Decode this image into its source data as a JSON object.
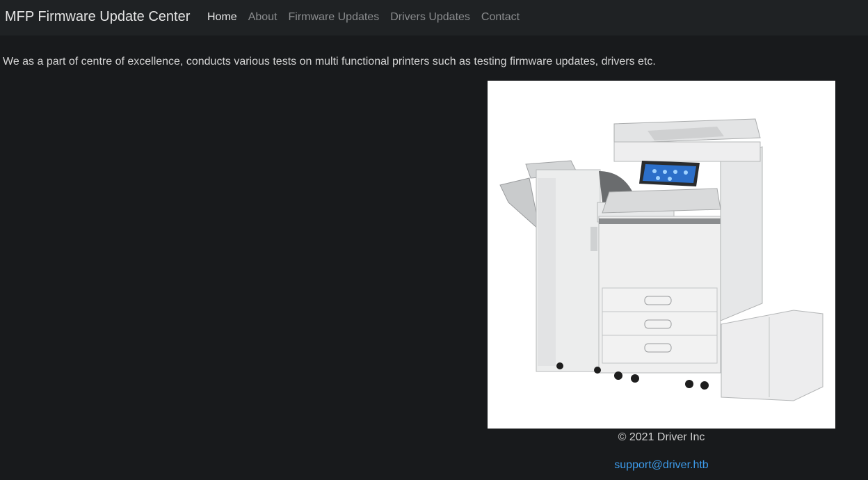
{
  "navbar": {
    "brand": "MFP Firmware Update Center",
    "links": [
      {
        "label": "Home",
        "active": true
      },
      {
        "label": "About",
        "active": false
      },
      {
        "label": "Firmware Updates",
        "active": false
      },
      {
        "label": "Drivers Updates",
        "active": false
      },
      {
        "label": "Contact",
        "active": false
      }
    ]
  },
  "main": {
    "intro": "We as a part of centre of excellence, conducts various tests on multi functional printers such as testing firmware updates, drivers etc.",
    "image": "printer-photo"
  },
  "footer": {
    "copyright": "© 2021 Driver Inc",
    "email": "support@driver.htb"
  },
  "colors": {
    "background": "#181a1c",
    "navbar": "#1f2224",
    "link": "#3d9bea"
  }
}
